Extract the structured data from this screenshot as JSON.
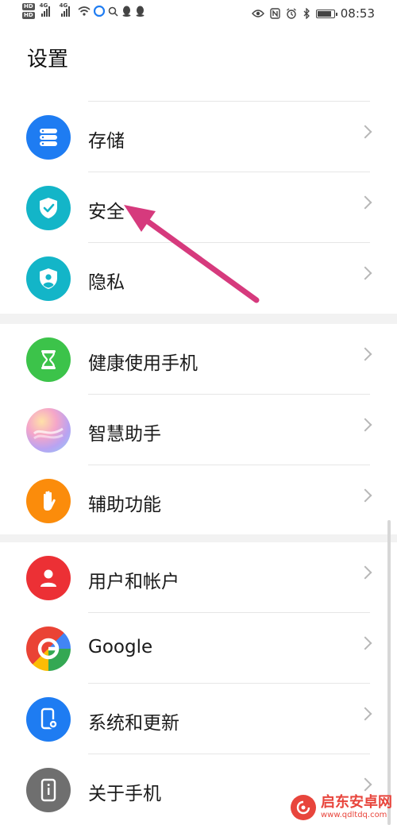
{
  "status_bar": {
    "hd1": "HD",
    "hd2": "HD",
    "net1": "4G",
    "net2": "4G",
    "time": "08:53",
    "icons": [
      "hd-icon",
      "signal-icon",
      "wifi-icon",
      "browser-icon",
      "search-icon",
      "qq-icon",
      "qq-icon",
      "eye-icon",
      "nfc-icon",
      "alarm-icon",
      "bluetooth-icon",
      "battery-icon"
    ]
  },
  "page": {
    "title": "设置"
  },
  "groups": [
    {
      "items": [
        {
          "label": "存储",
          "icon": "storage-icon",
          "color": "#1e7cf2"
        },
        {
          "label": "安全",
          "icon": "shield-check-icon",
          "color": "#13b5c8"
        },
        {
          "label": "隐私",
          "icon": "privacy-icon",
          "color": "#13b5c8"
        }
      ]
    },
    {
      "items": [
        {
          "label": "健康使用手机",
          "icon": "hourglass-icon",
          "color": "#3cc34a"
        },
        {
          "label": "智慧助手",
          "icon": "assistant-icon",
          "color": "#c89bf0"
        },
        {
          "label": "辅助功能",
          "icon": "hand-icon",
          "color": "#fb8c0b"
        }
      ]
    },
    {
      "items": [
        {
          "label": "用户和帐户",
          "icon": "user-icon",
          "color": "#ec3035"
        },
        {
          "label": "Google",
          "icon": "google-icon",
          "color": "#ffffff"
        },
        {
          "label": "系统和更新",
          "icon": "system-update-icon",
          "color": "#1e7cf2"
        },
        {
          "label": "关于手机",
          "icon": "phone-info-icon",
          "color": "#6f6f6f"
        }
      ]
    }
  ],
  "annotation": {
    "color": "#d63a7d"
  },
  "watermark": {
    "name": "启东安卓网",
    "url": "www.qdltdq.com"
  }
}
